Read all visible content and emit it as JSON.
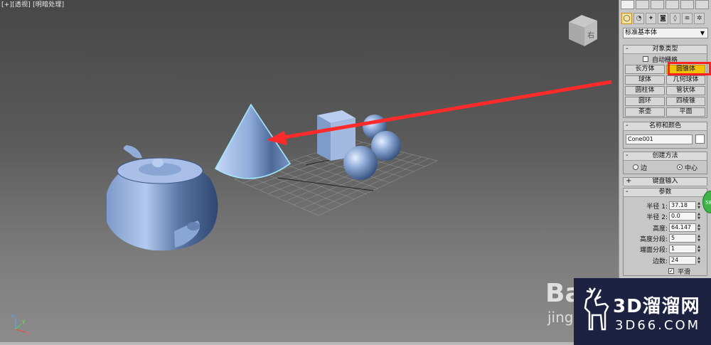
{
  "viewport": {
    "label_plus": "[+]",
    "label_view": "[透视]",
    "label_shade": "[明暗处理]"
  },
  "panel": {
    "category_dropdown": "标准基本体",
    "object_type": {
      "title": "对象类型",
      "autogrid_label": "自动栅格",
      "buttons": [
        "长方体",
        "圆锥体",
        "球体",
        "几何球体",
        "圆柱体",
        "管状体",
        "圆环",
        "四棱锥",
        "茶壶",
        "平面"
      ],
      "highlighted": "圆锥体"
    },
    "name_color": {
      "title": "名称和颜色",
      "name_value": "Cone001",
      "swatch_color": "#ffffff"
    },
    "creation_method": {
      "title": "创建方法",
      "options": [
        "边",
        "中心"
      ],
      "selected": "中心"
    },
    "keyboard_entry": {
      "title": "键盘输入"
    },
    "parameters": {
      "title": "参数",
      "radius1_label": "半径 1:",
      "radius1_value": "37.18",
      "radius2_label": "半径 2:",
      "radius2_value": "0.0",
      "height_label": "高度:",
      "height_value": "64.147",
      "height_segs_label": "高度分段:",
      "height_segs_value": "5",
      "cap_segs_label": "端面分段:",
      "cap_segs_value": "1",
      "sides_label": "边数:",
      "sides_value": "24",
      "smooth_label": "平滑"
    }
  },
  "overlay": {
    "green_button_label": "58",
    "watermark_cn": "3D溜溜网",
    "watermark_url": "3D66.COM",
    "baidu_text": "Ba",
    "baidu_sub": "jing"
  },
  "colors": {
    "highlight": "#f2c200",
    "annotation_red": "#ff2020",
    "object_blue": "#8aa6d4"
  }
}
